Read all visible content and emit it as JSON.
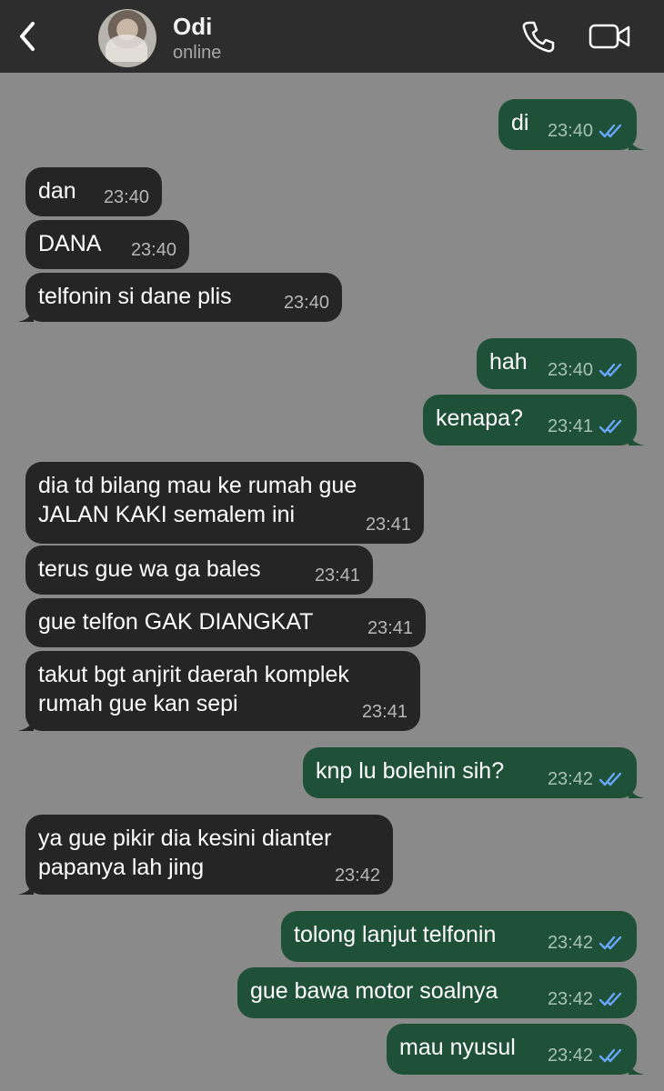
{
  "header": {
    "name": "Odi",
    "status": "online"
  },
  "messages": [
    {
      "dir": "out",
      "text": "di",
      "time": "23:40"
    },
    {
      "dir": "in",
      "text": "dan",
      "time": "23:40"
    },
    {
      "dir": "in",
      "text": "DANA",
      "time": "23:40"
    },
    {
      "dir": "in",
      "text": "telfonin si dane plis",
      "time": "23:40"
    },
    {
      "dir": "out",
      "text": "hah",
      "time": "23:40"
    },
    {
      "dir": "out",
      "text": "kenapa?",
      "time": "23:41"
    },
    {
      "dir": "in",
      "text": "dia td bilang mau ke rumah gue\nJALAN KAKI semalem ini",
      "time": "23:41"
    },
    {
      "dir": "in",
      "text": "terus gue wa ga bales",
      "time": "23:41"
    },
    {
      "dir": "in",
      "text": "gue telfon GAK DIANGKAT",
      "time": "23:41"
    },
    {
      "dir": "in",
      "text": "takut bgt anjrit daerah komplek\nrumah gue kan sepi",
      "time": "23:41"
    },
    {
      "dir": "out",
      "text": "knp lu bolehin sih?",
      "time": "23:42"
    },
    {
      "dir": "in",
      "text": "ya gue pikir dia kesini dianter\npapanya lah jing",
      "time": "23:42"
    },
    {
      "dir": "out",
      "text": "tolong lanjut telfonin",
      "time": "23:42"
    },
    {
      "dir": "out",
      "text": "gue bawa motor soalnya",
      "time": "23:42"
    },
    {
      "dir": "out",
      "text": "mau nyusul",
      "time": "23:42"
    }
  ],
  "colors": {
    "background": "#8a8a8a",
    "header": "#2d2d2d",
    "incoming_bubble": "#252525",
    "outgoing_bubble": "#1f5139",
    "read_tick": "#69a7ff"
  },
  "icons": {
    "back": "chevron-left-icon",
    "call": "phone-icon",
    "video": "video-camera-icon",
    "read": "double-check-icon"
  }
}
